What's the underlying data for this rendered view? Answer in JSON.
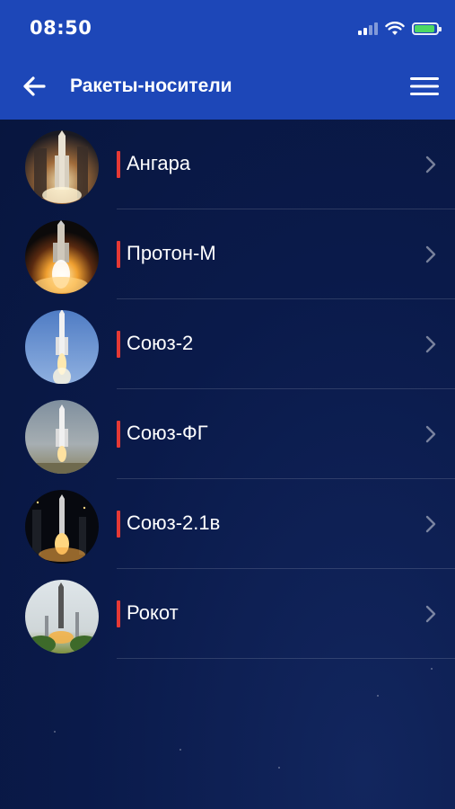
{
  "status_bar": {
    "time": "08:50",
    "icons": [
      "cellular-signal-icon",
      "wifi-icon",
      "battery-icon"
    ],
    "battery_color": "#4cd964"
  },
  "app_bar": {
    "title": "Ракеты-носители",
    "back_icon": "arrow-left-icon",
    "menu_icon": "hamburger-menu-icon",
    "background_color": "#1d47b8"
  },
  "rockets": [
    {
      "label": "Ангара",
      "thumbnail": "angara-launch-photo"
    },
    {
      "label": "Протон-М",
      "thumbnail": "proton-m-launch-photo"
    },
    {
      "label": "Союз-2",
      "thumbnail": "soyuz-2-launch-photo"
    },
    {
      "label": "Союз-ФГ",
      "thumbnail": "soyuz-fg-launch-photo"
    },
    {
      "label": "Союз-2.1в",
      "thumbnail": "soyuz-2-1v-launch-photo"
    },
    {
      "label": "Рокот",
      "thumbnail": "rokot-launch-photo"
    }
  ],
  "theme": {
    "list_background": "#0a1a4a",
    "accent": "#e53935",
    "chevron_icon": "chevron-right-icon"
  }
}
